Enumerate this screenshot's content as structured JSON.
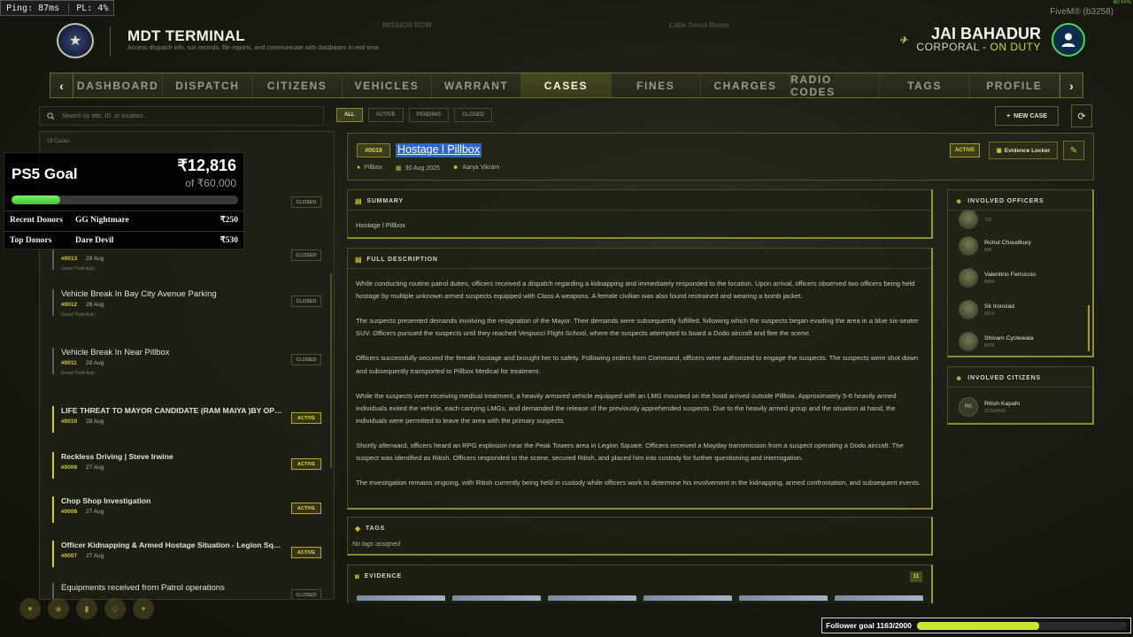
{
  "overlay": {
    "ping": "Ping: 87ms",
    "pl": "PL: 4%",
    "fivem": "FiveM® (b3258)",
    "fps": "60 FPS"
  },
  "header": {
    "title": "MDT TERMINAL",
    "subtitle": "Access dispatch info, run records, file reports, and communicate with databases in real time.",
    "ghost_left": "MISSION ROW",
    "ghost_right": "Little Seoul   Route",
    "user_name": "JAI BAHADUR",
    "user_rank": "CORPORAL",
    "user_status": "ON DUTY"
  },
  "nav": {
    "tabs": [
      "DASHBOARD",
      "DISPATCH",
      "CITIZENS",
      "VEHICLES",
      "WARRANT",
      "CASES",
      "FINES",
      "CHARGES",
      "RADIO CODES",
      "TAGS",
      "PROFILE"
    ],
    "active": "CASES"
  },
  "search": {
    "placeholder": "Search by title, ID, or location..."
  },
  "filters": [
    "ALL",
    "ACTIVE",
    "PENDING",
    "CLOSED"
  ],
  "actions": {
    "new_case": "NEW CASE"
  },
  "list": {
    "count": "18 Cases",
    "cases": [
      {
        "title": "",
        "id": "",
        "date": "",
        "charge": "",
        "status": "CLOSED",
        "active": false
      },
      {
        "title": "",
        "id": "#0013",
        "date": "28 Aug",
        "charge": "Grand Theft Auto",
        "status": "CLOSED",
        "active": false
      },
      {
        "title": "Vehicle Break In Bay City Avenue Parking",
        "id": "#0012",
        "date": "28 Aug",
        "charge": "Grand Theft Auto",
        "status": "CLOSED",
        "active": false
      },
      {
        "title": "Vehicle Break In Near Pillbox",
        "id": "#0011",
        "date": "28 Aug",
        "charge": "Grand Theft Auto",
        "status": "CLOSED",
        "active": false
      },
      {
        "title": "LIFE THREAT TO MAYOR CANDIDATE (RAM MAIYA )BY OPONENT'S MEN",
        "id": "#0010",
        "date": "28 Aug",
        "charge": "",
        "status": "ACTIVE",
        "active": true
      },
      {
        "title": "Reckless Driving | Steve Irwine",
        "id": "#0009",
        "date": "27 Aug",
        "charge": "",
        "status": "ACTIVE",
        "active": true
      },
      {
        "title": "Chop Shop Investigation",
        "id": "#0008",
        "date": "27 Aug",
        "charge": "",
        "status": "ACTIVE",
        "active": true
      },
      {
        "title": "Officer Kidnapping & Armed Hostage Situation - Legion Square",
        "id": "#0007",
        "date": "27 Aug",
        "charge": "",
        "status": "ACTIVE",
        "active": true
      },
      {
        "title": "Equipments received from Patrol operations",
        "id": "",
        "date": "",
        "charge": "",
        "status": "CLOSED",
        "active": false
      }
    ]
  },
  "donation": {
    "title": "PS5 Goal",
    "amount": "₹12,816",
    "target": "of ₹60,000",
    "progress": 0.2136,
    "recent_label": "Recent Donors",
    "recent_name": "GG Nightmare",
    "recent_amount": "₹250",
    "top_label": "Top Donors",
    "top_name": "Dare Devil",
    "top_amount": "₹530"
  },
  "case": {
    "number": "#0018",
    "title": "Hostage l Pillbox",
    "location": "Pillbox",
    "date": "30 Aug 2025",
    "officer": "Aarya Vikram",
    "status": "ACTIVE",
    "locker": "Evidence Locker",
    "summary_heading": "SUMMARY",
    "summary": "Hostage l Pillbox",
    "description_heading": "FULL DESCRIPTION",
    "description": [
      "While conducting routine patrol duties, officers received a dispatch regarding a kidnapping and immediately responded to the location. Upon arrival, officers observed two officers being held hostage by multiple unknown armed suspects equipped with Class A weapons. A female civilian was also found restrained and wearing a bomb jacket.",
      "The suspects presented demands involving the resignation of the Mayor. Their demands were subsequently fulfilled, following which the suspects began evading the area in a blue six-seater SUV. Officers pursued the suspects until they reached Vespucci Flight School, where the suspects attempted to board a Dodo aircraft and flee the scene.",
      "Officers successfully secured the female hostage and brought her to safety. Following orders from Command, officers were authorized to engage the suspects. The suspects were shot down and subsequently transported to Pillbox Medical for treatment.",
      "While the suspects were receiving medical treatment, a heavily armored vehicle equipped with an LMG mounted on the hood arrived outside Pillbox. Approximately 5-6 heavily armed individuals exited the vehicle, each carrying LMGs, and demanded the release of the previously apprehended suspects. Due to the heavily armed group and the situation at hand, the individuals were permitted to leave the area with the primary suspects.",
      "Shortly afterward, officers heard an RPG explosion near the Peak Towers area in Legion Square. Officers received a Mayday transmission from a suspect operating a Dodo aircraft. The suspect was identified as Ritish. Officers responded to the scene, secured Ritish, and placed him into custody for further questioning and interrogation.",
      "The investigation remains ongoing, with Ritish currently being held in custody while officers work to determine his involvement in the kidnapping, armed confrontation, and subsequent events."
    ],
    "tags_heading": "TAGS",
    "tags_empty": "No tags assigned",
    "evidence_heading": "EVIDENCE",
    "evidence_count": "11"
  },
  "officers": {
    "heading": "INVOLVED OFFICERS",
    "list": [
      {
        "name": "",
        "badge": "703"
      },
      {
        "name": "Rohul Choudhury",
        "badge": "858"
      },
      {
        "name": "Valentino Ferruccio",
        "badge": "8004"
      },
      {
        "name": "Sk Ironclad",
        "badge": "8014"
      },
      {
        "name": "Shivam Cyclewala",
        "badge": "8075"
      }
    ]
  },
  "citizens": {
    "heading": "INVOLVED CITIZENS",
    "list": [
      {
        "initials": "RK",
        "name": "Ritish Kapahi",
        "id": "ZDS04690"
      }
    ]
  },
  "follower": {
    "label": "Follower goal 1163/2000",
    "progress": 0.5815
  }
}
